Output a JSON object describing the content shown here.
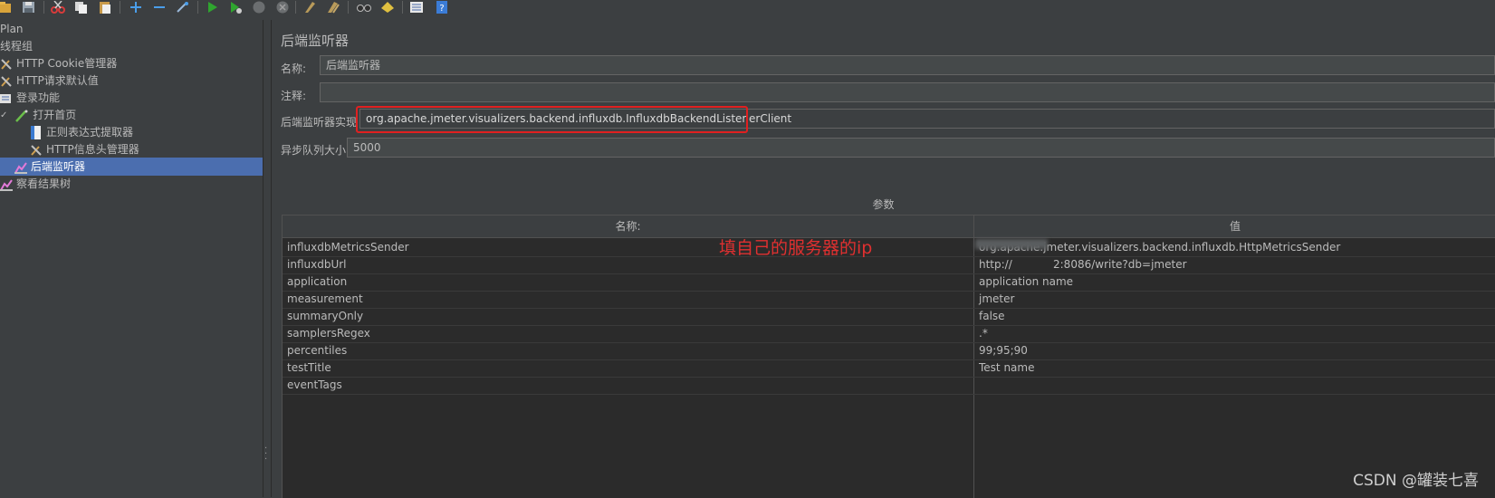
{
  "tree": {
    "items": [
      {
        "label": "Plan",
        "icon": "test-plan-icon"
      },
      {
        "label": "线程组",
        "icon": "thread-group-icon"
      },
      {
        "label": "HTTP Cookie管理器",
        "icon": "wrench-icon"
      },
      {
        "label": "HTTP请求默认值",
        "icon": "wrench-icon"
      },
      {
        "label": "登录功能",
        "icon": "transaction-icon"
      },
      {
        "label": "打开首页",
        "icon": "pipette-icon"
      },
      {
        "label": "正则表达式提取器",
        "icon": "document-icon"
      },
      {
        "label": "HTTP信息头管理器",
        "icon": "wrench-icon"
      },
      {
        "label": "后端监听器",
        "icon": "listener-icon"
      },
      {
        "label": "察看结果树",
        "icon": "listener-icon"
      }
    ],
    "selected": "后端监听器",
    "expand_glyph": "✓"
  },
  "panel": {
    "title": "后端监听器",
    "name_label": "名称:",
    "name_value": "后端监听器",
    "comment_label": "注释:",
    "comment_value": "",
    "impl_label": "后端监听器实现",
    "impl_value": "org.apache.jmeter.visualizers.backend.influxdb.InfluxdbBackendListenerClient",
    "queue_label": "异步队列大小",
    "queue_value": "5000"
  },
  "params": {
    "title": "参数",
    "col_name": "名称:",
    "col_value": "值",
    "rows": [
      {
        "name": "influxdbMetricsSender",
        "value": "org.apache.jmeter.visualizers.backend.influxdb.HttpMetricsSender"
      },
      {
        "name": "influxdbUrl",
        "value": "http://",
        "value_tail": "2:8086/write?db=jmeter"
      },
      {
        "name": "application",
        "value": "application name"
      },
      {
        "name": "measurement",
        "value": "jmeter"
      },
      {
        "name": "summaryOnly",
        "value": "false"
      },
      {
        "name": "samplersRegex",
        "value": ".*"
      },
      {
        "name": "percentiles",
        "value": "99;95;90"
      },
      {
        "name": "testTitle",
        "value": "Test name"
      },
      {
        "name": "eventTags",
        "value": ""
      }
    ]
  },
  "annotation": "填自己的服务器的ip",
  "watermark": "CSDN @罐装七喜",
  "colors": {
    "background": "#3c3f41",
    "selection": "#4b6eaf",
    "annotation": "#e03030",
    "highlight_box": "#e02020"
  },
  "toolbar_icons": [
    "open-icon",
    "save-icon",
    "cut-icon",
    "copy-icon",
    "paste-icon",
    "expand-icon",
    "collapse-icon",
    "toggle-icon",
    "start-icon",
    "start-no-pause-icon",
    "stop-icon",
    "shutdown-icon",
    "clear-icon",
    "clear-all-icon",
    "search-icon",
    "reset-search-icon",
    "function-helper-icon",
    "help-icon"
  ]
}
